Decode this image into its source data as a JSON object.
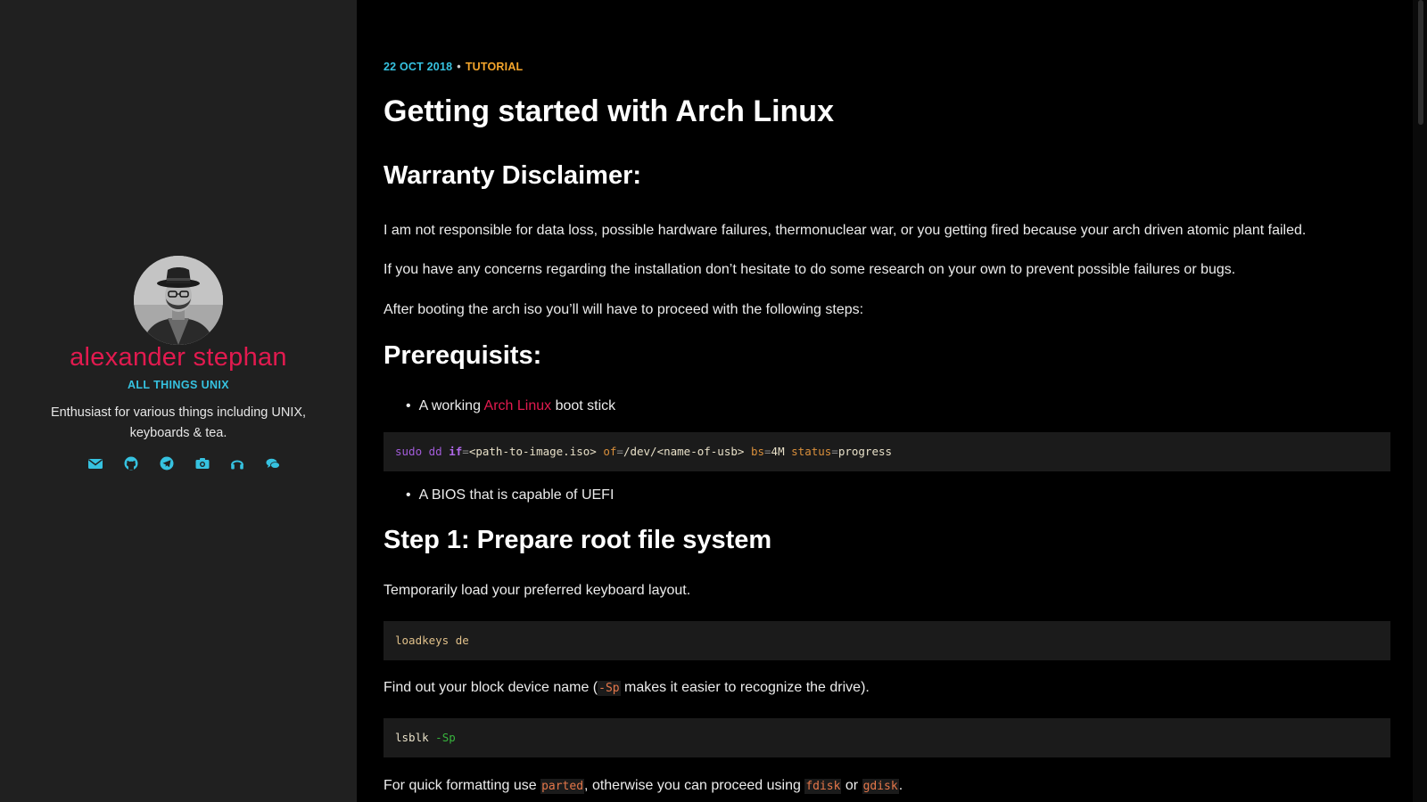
{
  "sidebar": {
    "name": "alexander stephan",
    "tagline": "ALL THINGS UNIX",
    "bio": "Enthusiast for various things including UNIX, keyboards & tea.",
    "social": [
      "email-icon",
      "github-icon",
      "telegram-icon",
      "camera-icon",
      "headphones-icon",
      "chat-icon"
    ]
  },
  "colors": {
    "accent_red": "#e21a4f",
    "accent_cyan": "#36c2e0",
    "accent_orange": "#f4a52b",
    "sidebar_bg": "#202020",
    "main_bg": "#000000"
  },
  "post": {
    "date": "22 OCT 2018",
    "separator": "•",
    "category": "TUTORIAL",
    "title": "Getting started with Arch Linux",
    "h_disclaimer": "Warranty Disclaimer:",
    "p1": "I am not responsible for data loss, possible hardware failures, thermonuclear war, or you getting fired because your arch driven atomic plant failed.",
    "p2": "If you have any concerns regarding the installation don’t hesitate to do some research on your own to prevent possible failures or bugs.",
    "p3": "After booting the arch iso you’ll will have to proceed with the following steps:",
    "h_prereq": "Prerequisits:",
    "bullet1_pre": "A working ",
    "bullet1_link": "Arch Linux",
    "bullet1_post": " boot stick",
    "dd_cmd": {
      "sudo": "sudo",
      "dd": "dd",
      "if_key": "if",
      "if_val": "<path-to-image.iso>",
      "of_key": "of",
      "of_val": "/dev/<name-of-usb>",
      "bs_key": "bs",
      "bs_val": "4M",
      "status_key": "status",
      "status_val": "progress",
      "eq": "="
    },
    "bullet2": "A BIOS that is capable of UEFI",
    "h_step1": "Step 1: Prepare root file system",
    "p4": "Temporarily load your preferred keyboard layout.",
    "loadkeys_cmd": "loadkeys de",
    "p5_pre": "Find out your block device name (",
    "p5_code": "-Sp",
    "p5_post": " makes it easier to recognize the drive).",
    "lsblk_cmd": "lsblk",
    "lsblk_flag": "-Sp",
    "p6_pre": "For quick formatting use ",
    "p6_code1": "parted",
    "p6_mid": ", otherwise you can proceed using ",
    "p6_code2": "fdisk",
    "p6_or": " or ",
    "p6_code3": "gdisk",
    "p6_end": "."
  }
}
